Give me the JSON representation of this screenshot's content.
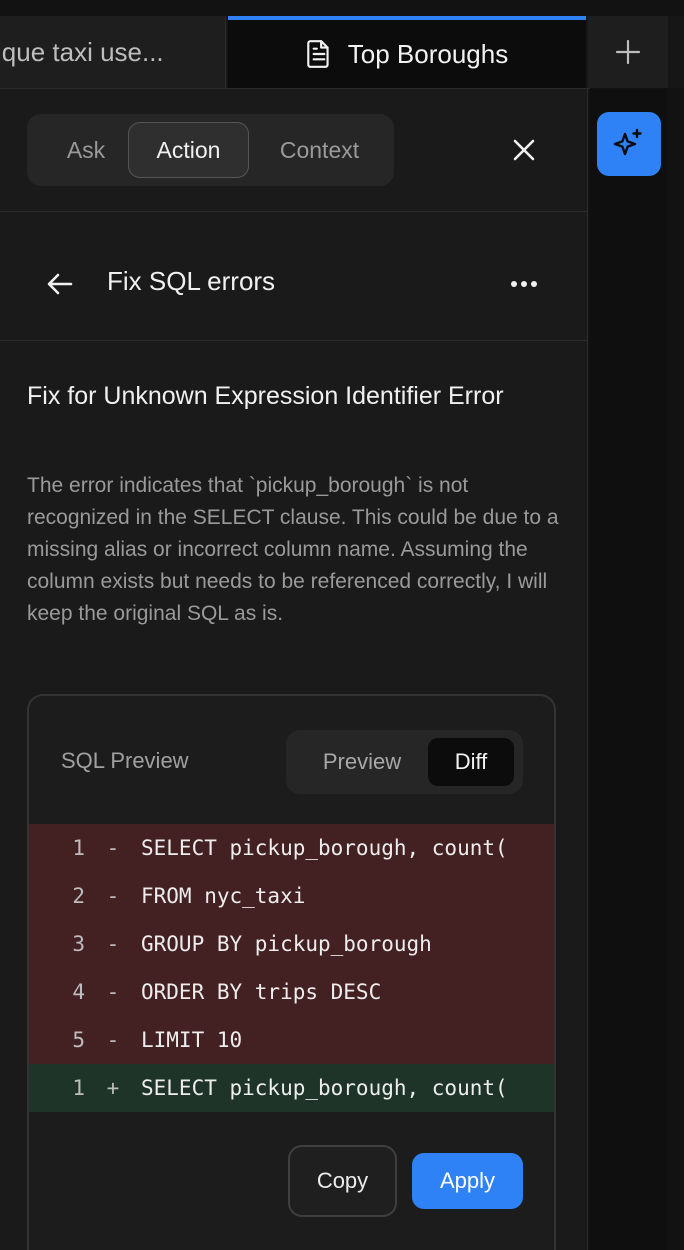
{
  "tabs": [
    {
      "label": "ique taxi use...",
      "active": false
    },
    {
      "label": "Top Boroughs",
      "active": true,
      "icon": "document-icon"
    }
  ],
  "tab_add_icon": "plus-icon",
  "assistant": {
    "mode_tabs": [
      "Ask",
      "Action",
      "Context"
    ],
    "selected_mode": "Action",
    "close_icon": "close-icon",
    "ai_icon": "sparkles-icon"
  },
  "header": {
    "back_icon": "arrow-left-icon",
    "title": "Fix SQL errors",
    "more_icon": "more-horizontal-icon"
  },
  "fix": {
    "title": "Fix for Unknown Expression Identifier Error",
    "description": "The error indicates that `pickup_borough` is not recognized in the SELECT clause. This could be due to a missing alias or incorrect column name. Assuming the column exists but needs to be referenced correctly, I will keep the original SQL as is."
  },
  "sql_preview": {
    "label": "SQL Preview",
    "view_options": [
      "Preview",
      "Diff"
    ],
    "selected_view": "Diff",
    "diff_lines": [
      {
        "num": "1",
        "sign": "-",
        "code": "SELECT pickup_borough, count(",
        "type": "removed"
      },
      {
        "num": "2",
        "sign": "-",
        "code": "FROM nyc_taxi",
        "type": "removed"
      },
      {
        "num": "3",
        "sign": "-",
        "code": "GROUP BY pickup_borough",
        "type": "removed"
      },
      {
        "num": "4",
        "sign": "-",
        "code": "ORDER BY trips DESC",
        "type": "removed"
      },
      {
        "num": "5",
        "sign": "-",
        "code": "LIMIT 10",
        "type": "removed"
      },
      {
        "num": "1",
        "sign": "+",
        "code": "SELECT pickup_borough, count(",
        "type": "added"
      }
    ],
    "copy_label": "Copy",
    "apply_label": "Apply"
  },
  "colors": {
    "accent": "#2f82f5",
    "removed_bg": "#432022",
    "added_bg": "#1e3428",
    "panel_bg": "#1a1a1a"
  }
}
